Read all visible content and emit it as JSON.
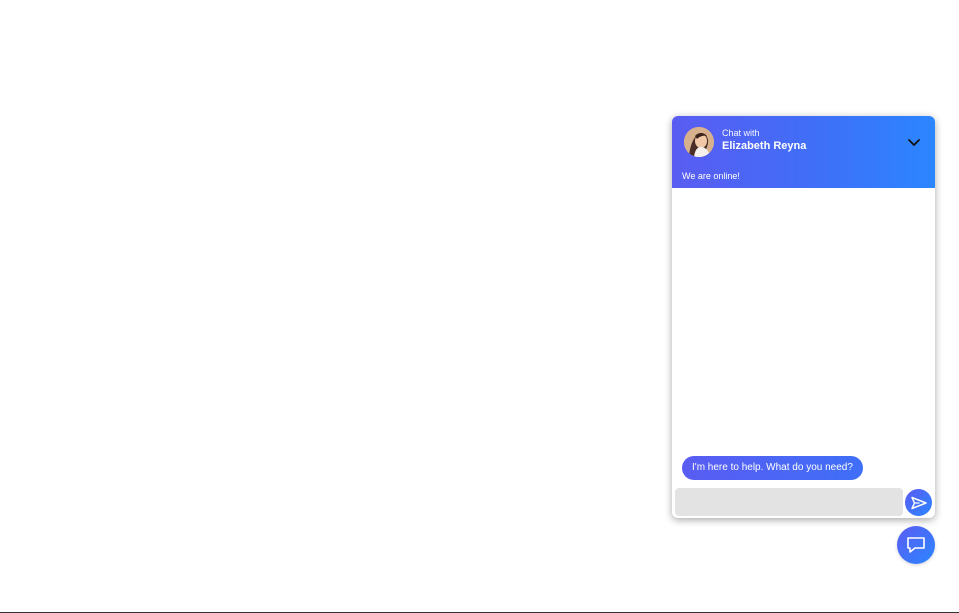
{
  "chat": {
    "header": {
      "subtitle": "Chat with",
      "agent_name": "Elizabeth Reyna",
      "status": "We are online!"
    },
    "messages": [
      {
        "from": "agent",
        "text": "I'm here to help. What do you need?"
      }
    ],
    "input": {
      "placeholder": "",
      "value": ""
    },
    "icons": {
      "collapse": "chevron-down-icon",
      "send": "send-icon",
      "launcher": "chat-bubble-icon"
    }
  },
  "colors": {
    "gradient_start": "#5a5cf2",
    "gradient_end": "#2b86ff",
    "input_bg": "#e3e3e3"
  }
}
